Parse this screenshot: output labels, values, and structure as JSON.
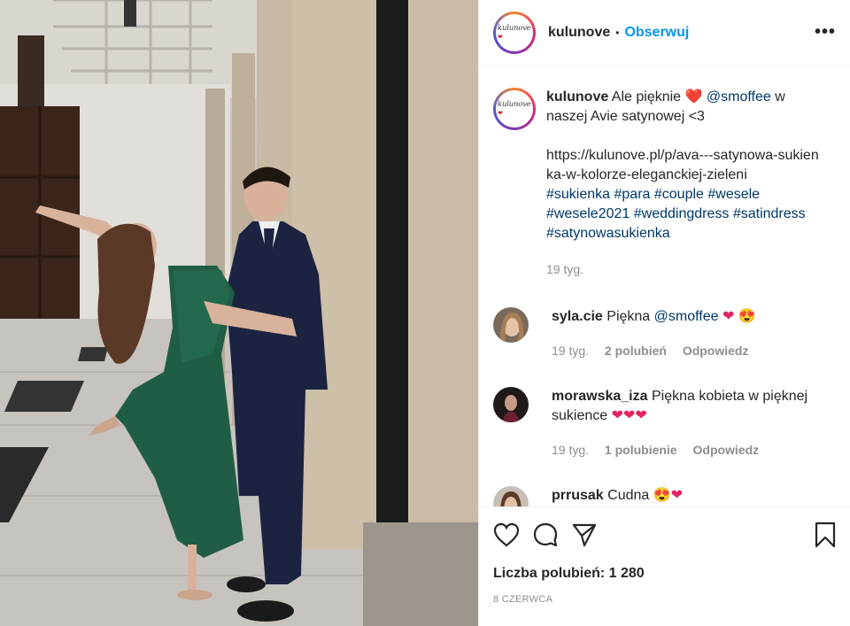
{
  "post": {
    "username": "kulunove",
    "logo_text": "kulunove",
    "follow_label": "Obserwuj",
    "more_label": "•••",
    "caption": {
      "user": "kulunove",
      "text_before": "Ale pięknie",
      "mention": "@smoffee",
      "text_after": "w naszej Avie satynowej <3",
      "url": "https://kulunove.pl/p/ava---satynowa-sukienka-w-kolorze-eleganckiej-zieleni",
      "hashtags": [
        "#sukienka",
        "#para",
        "#couple",
        "#wesele",
        "#wesele2021",
        "#weddingdress",
        "#satindress",
        "#satynowasukienka"
      ],
      "time": "19 tyg."
    },
    "comments": [
      {
        "user": "syla.cie",
        "text": "Piękna",
        "mention": "@smoffee",
        "emoji": "❤ 😍",
        "time": "19 tyg.",
        "likes": "2 polubień",
        "reply": "Odpowiedz"
      },
      {
        "user": "morawska_iza",
        "text": "Piękna kobieta w pięknej sukience",
        "emoji": "❤❤❤",
        "time": "19 tyg.",
        "likes": "1 polubienie",
        "reply": "Odpowiedz"
      },
      {
        "user": "prrusak",
        "text": "Cudna",
        "emoji": "😍❤"
      }
    ],
    "likes_label": "Liczba polubień: 1 280",
    "date": "8 CZERWCA"
  },
  "colors": {
    "link": "#00376b",
    "follow": "#0095f6",
    "heart": "#e0245e",
    "muted": "#8e8e8e"
  }
}
